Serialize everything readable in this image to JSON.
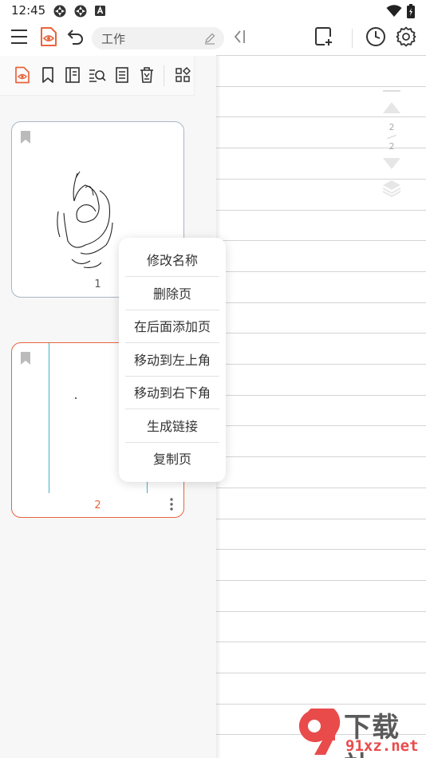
{
  "status_bar": {
    "time": "12:45",
    "left_icons": [
      "sync-icon",
      "sync-icon",
      "notification-a-icon"
    ],
    "right_icons": [
      "wifi-icon",
      "battery-icon"
    ]
  },
  "toolbar": {
    "menu_icon": "hamburger-menu-icon",
    "view_icon": "document-eye-icon",
    "undo_icon": "undo-icon",
    "notebook_name": "工作",
    "rename_icon": "pencil-icon",
    "collapse_icon": "collapse-left-icon",
    "add_page_icon": "add-page-icon",
    "history_icon": "clock-icon",
    "settings_icon": "gear-icon",
    "accent_color": "#e8643c"
  },
  "panel_toolbar": {
    "icons": [
      "document-eye-icon",
      "bookmark-icon",
      "outline-icon",
      "search-list-icon",
      "notes-icon",
      "trash-icon",
      "grid-icon"
    ]
  },
  "pages": [
    {
      "number": "1",
      "selected": false
    },
    {
      "number": "2",
      "selected": true
    }
  ],
  "context_menu": {
    "items": [
      "修改名称",
      "删除页",
      "在后面添加页",
      "移动到左上角",
      "移动到右下角",
      "生成链接",
      "复制页"
    ]
  },
  "page_indicator": {
    "current": "2",
    "total": "2"
  },
  "watermark": {
    "title": "下载站",
    "url": "91xz.net",
    "logo_text": "9"
  }
}
